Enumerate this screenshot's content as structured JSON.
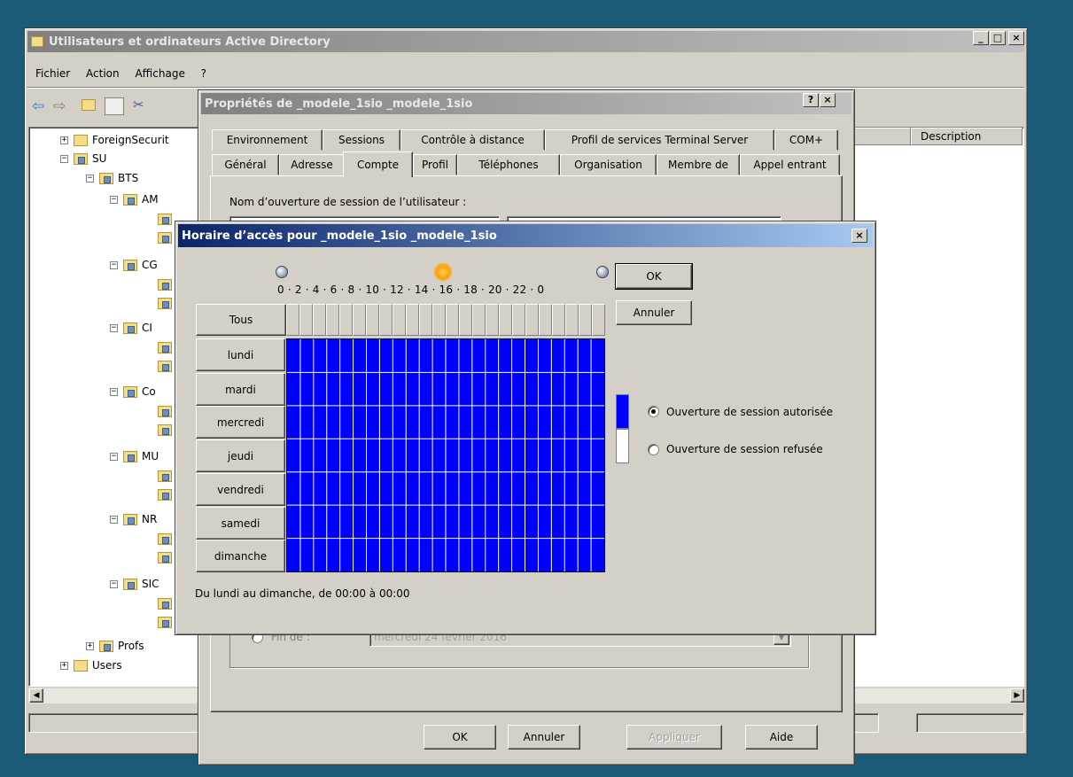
{
  "ad_window": {
    "title": "Utilisateurs et ordinateurs Active Directory",
    "menu": [
      "Fichier",
      "Action",
      "Affichage",
      "?"
    ],
    "column_description": "Description",
    "tree": [
      {
        "label": "ForeignSecurit",
        "expander": "+",
        "type": "folder"
      },
      {
        "label": "SU",
        "expander": "−",
        "type": "ou"
      },
      {
        "label": "BTS",
        "expander": "−",
        "type": "ou"
      },
      {
        "label": "AM",
        "expander": "−",
        "type": "ou"
      },
      {
        "label": "CG",
        "expander": "−",
        "type": "ou"
      },
      {
        "label": "CI",
        "expander": "−",
        "type": "ou"
      },
      {
        "label": "Co",
        "expander": "−",
        "type": "ou"
      },
      {
        "label": "MU",
        "expander": "−",
        "type": "ou"
      },
      {
        "label": "NR",
        "expander": "−",
        "type": "ou"
      },
      {
        "label": "SIC",
        "expander": "−",
        "type": "ou"
      },
      {
        "label": "Profs",
        "expander": "+",
        "type": "ou"
      },
      {
        "label": "Users",
        "expander": "+",
        "type": "folder"
      }
    ]
  },
  "props_window": {
    "title": "Propriétés de _modele_1sio _modele_1sio",
    "help_btn": "?",
    "close_btn": "×",
    "tabs_row1": [
      "Environnement",
      "Sessions",
      "Contrôle à distance",
      "Profil de services Terminal Server",
      "COM+"
    ],
    "tabs_row2": [
      "Général",
      "Adresse",
      "Compte",
      "Profil",
      "Téléphones",
      "Organisation",
      "Membre de",
      "Appel entrant"
    ],
    "active_tab": "Compte",
    "logon_label": "Nom d’ouverture de session de l’utilisateur :",
    "expiry_label": "Fin de :",
    "expiry_date": "mercredi   24    février    2016",
    "buttons": {
      "ok": "OK",
      "cancel": "Annuler",
      "apply": "Appliquer",
      "help": "Aide"
    }
  },
  "hours_dialog": {
    "title": "Horaire d’accès pour _modele_1sio _modele_1sio",
    "close_btn": "×",
    "hour_scale": "0 · 2 · 4 · 6 · 8 · 10 · 12 · 14 · 16 · 18 · 20 · 22 · 0",
    "all_label": "Tous",
    "days": [
      "lundi",
      "mardi",
      "mercredi",
      "jeudi",
      "vendredi",
      "samedi",
      "dimanche"
    ],
    "ok": "OK",
    "cancel": "Annuler",
    "allowed_label": "Ouverture de session autorisée",
    "denied_label": "Ouverture de session refusée",
    "selected_option": "allowed",
    "summary": "Du lundi au dimanche, de 00:00 à 00:00",
    "colors": {
      "allowed": "#0000ff",
      "denied": "#ffffff"
    }
  }
}
